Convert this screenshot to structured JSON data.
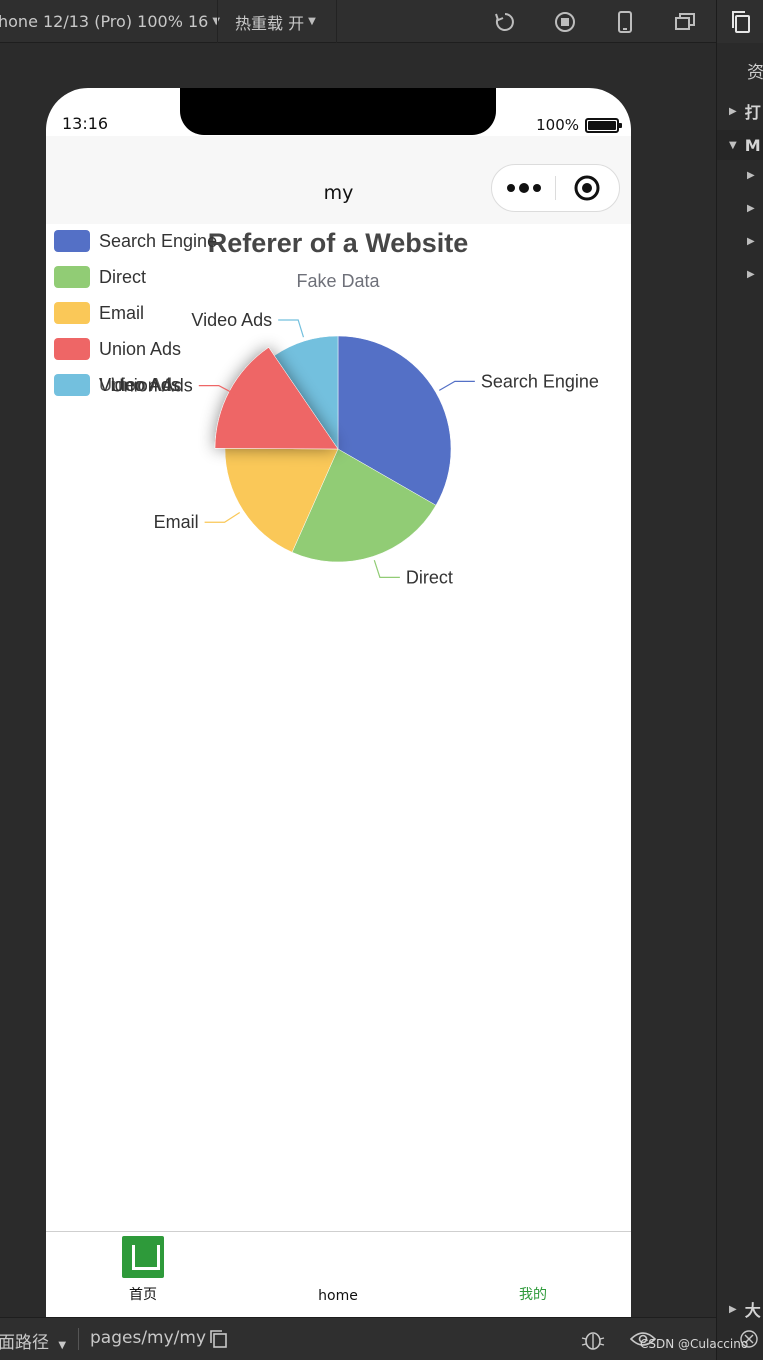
{
  "toolbar": {
    "device_label": "hone 12/13 (Pro) 100% 16",
    "hotreload_label": "热重载 开",
    "icons": [
      "refresh-icon",
      "stop-icon",
      "phone-icon",
      "window-icon"
    ]
  },
  "right_panel": {
    "label": "资",
    "rows": [
      "打",
      "M",
      "大"
    ]
  },
  "status": {
    "time": "13:16",
    "battery": "100%",
    "battery_level": 1.0
  },
  "navbar": {
    "title": "my"
  },
  "chart_data": {
    "type": "pie",
    "title": "Referer of a Website",
    "subtitle": "Fake Data",
    "legend_position": "top-left",
    "series": [
      {
        "name": "Search Engine",
        "value": 1048,
        "color": "#5470c6"
      },
      {
        "name": "Direct",
        "value": 735,
        "color": "#91cc75"
      },
      {
        "name": "Email",
        "value": 580,
        "color": "#fac858"
      },
      {
        "name": "Union Ads",
        "value": 484,
        "color": "#ee6666"
      },
      {
        "name": "Video Ads",
        "value": 300,
        "color": "#73c0de"
      }
    ],
    "emphasized": "Union Ads",
    "tooltip_overlap_text": "Union Ads"
  },
  "tabbar": {
    "items": [
      {
        "label": "首页",
        "color": "#111111"
      },
      {
        "label": "home",
        "color": "#111111"
      },
      {
        "label": "我的",
        "color": "#2e9a3a"
      }
    ]
  },
  "bottombar": {
    "path_label": "面路径",
    "path_value": "pages/my/my"
  },
  "watermark": "CSDN @Culaccino"
}
